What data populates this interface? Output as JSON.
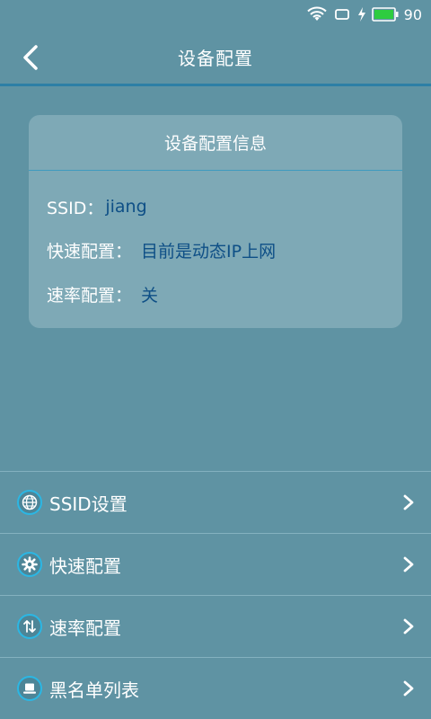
{
  "status_bar": {
    "battery_level": "90",
    "icons": [
      "wifi-icon",
      "screen-rotation-icon",
      "charging-icon",
      "battery-icon"
    ],
    "battery_color": "#2ecc40"
  },
  "header": {
    "title": "设备配置",
    "back_icon": "chevron-left-icon"
  },
  "info_card": {
    "title": "设备配置信息",
    "rows": [
      {
        "label": "SSID：",
        "value": "jiang"
      },
      {
        "label": "快速配置：",
        "value": "目前是动态IP上网"
      },
      {
        "label": "速率配置：",
        "value": "关"
      }
    ],
    "value_color": "#0e4f86"
  },
  "menu": {
    "items": [
      {
        "label": "SSID设置",
        "icon": "globe-icon"
      },
      {
        "label": "快速配置",
        "icon": "gear-icon"
      },
      {
        "label": "速率配置",
        "icon": "up-down-arrows-icon"
      },
      {
        "label": "黑名单列表",
        "icon": "laptop-icon"
      }
    ],
    "accent_color": "#2bb7e4"
  }
}
